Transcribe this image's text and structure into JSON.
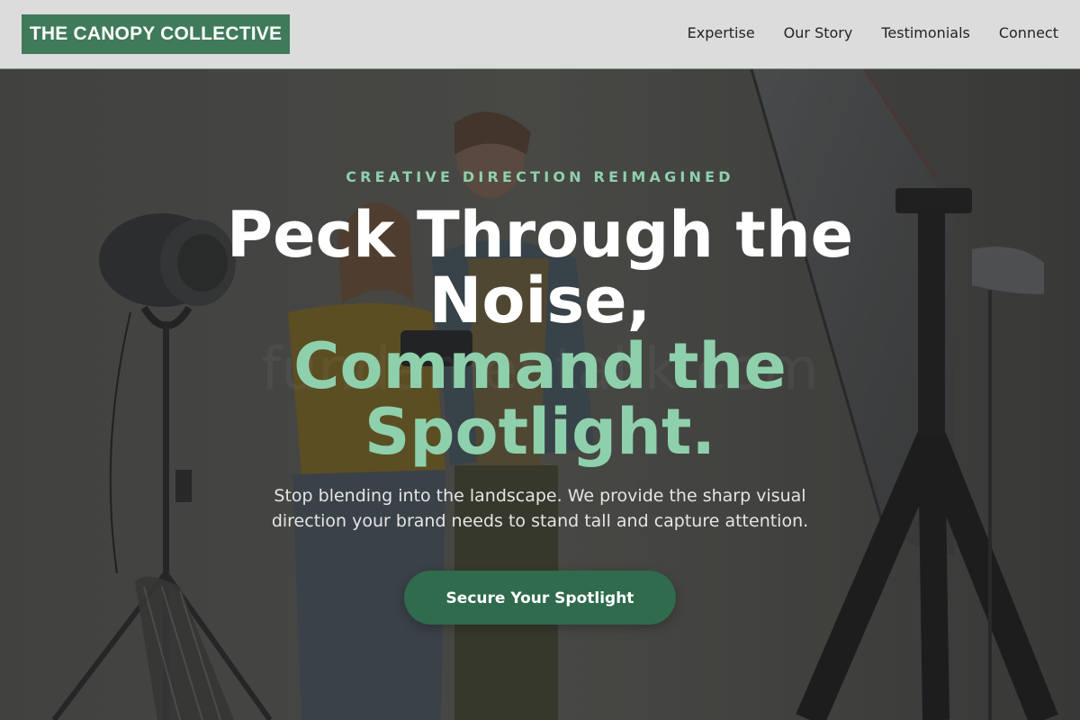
{
  "header": {
    "logo_text": "THE CANOPY COLLECTIVE",
    "nav": [
      {
        "label": "Expertise"
      },
      {
        "label": "Our Story"
      },
      {
        "label": "Testimonials"
      },
      {
        "label": "Connect"
      }
    ]
  },
  "hero": {
    "eyebrow": "CREATIVE DIRECTION REIMAGINED",
    "headline_line1": "Peck Through the Noise,",
    "headline_line2": "Command the Spotlight.",
    "subtext": "Stop blending into the landscape. We provide the sharp visual direction your brand needs to stand tall and capture attention.",
    "cta_label": "Secure Your Spotlight",
    "watermark": "fundamentallk.com"
  },
  "colors": {
    "header_bg": "#dcdcdc",
    "logo_bg": "#3f7a5a",
    "accent_green": "#8fd0ac",
    "cta_bg": "#2f6b4c",
    "nav_text": "#1f2326"
  }
}
